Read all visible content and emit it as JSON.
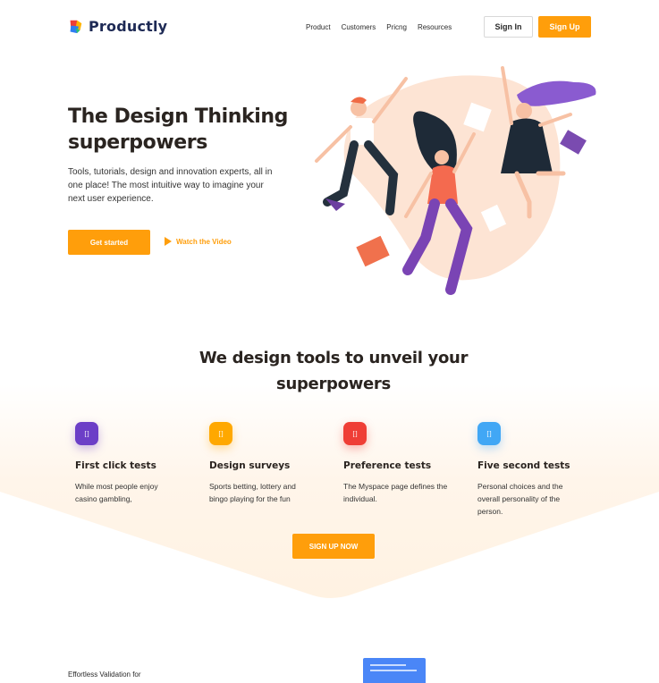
{
  "brand": {
    "name": "Productly"
  },
  "nav": {
    "items": [
      "Product",
      "Customers",
      "Pricng",
      "Resources"
    ]
  },
  "header": {
    "signin_label": "Sign In",
    "signup_label": "Sign Up"
  },
  "hero": {
    "title": "The Design Thinking superpowers",
    "description": "Tools, tutorials, design and innovation experts, all in one place! The most intuitive way to imagine your next user experience.",
    "cta_label": "Get started",
    "video_label": "Watch the Video"
  },
  "section": {
    "title": "We design tools to unveil your superpowers",
    "cta_label": "SIGN UP NOW",
    "features": [
      {
        "icon": "feature-icon",
        "glyph": "[]",
        "color": "#6c3fc7",
        "title": "First click tests",
        "description": "While most people enjoy casino gambling,"
      },
      {
        "icon": "feature-icon",
        "glyph": "[]",
        "color": "#ffa800",
        "title": "Design surveys",
        "description": "Sports betting, lottery and bingo playing for the fun"
      },
      {
        "icon": "feature-icon",
        "glyph": "[]",
        "color": "#ef3e36",
        "title": "Preference tests",
        "description": "The Myspace page defines the individual."
      },
      {
        "icon": "feature-icon",
        "glyph": "[]",
        "color": "#41a7f5",
        "title": "Five second tests",
        "description": "Personal choices and the overall personality of the person."
      }
    ]
  },
  "footer": {
    "teaser": "Effortless Validation for"
  },
  "colors": {
    "accent": "#ff9e0b",
    "brand_text": "#1e2a55",
    "soft_bg": "#fff3e6"
  }
}
